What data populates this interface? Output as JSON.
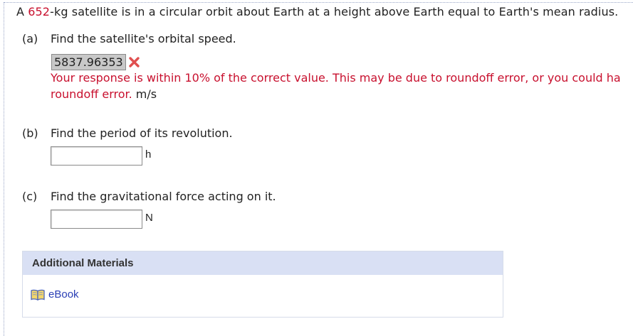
{
  "question": {
    "prefix": "A ",
    "mass": "652",
    "suffix": "-kg satellite is in a circular orbit about Earth at a height above Earth equal to Earth's mean radius."
  },
  "parts": {
    "a": {
      "label": "(a)",
      "prompt": "Find the satellite's orbital speed.",
      "answer_value": "5837.96353",
      "feedback_line1": "Your response is within 10% of the correct value. This may be due to roundoff error, or you could ha",
      "feedback_line2": "roundoff error.",
      "unit": "m/s"
    },
    "b": {
      "label": "(b)",
      "prompt": "Find the period of its revolution.",
      "input_value": "",
      "unit": "h"
    },
    "c": {
      "label": "(c)",
      "prompt": "Find the gravitational force acting on it.",
      "input_value": "",
      "unit": "N"
    }
  },
  "materials": {
    "title": "Additional Materials",
    "ebook_label": "eBook"
  },
  "colors": {
    "error_red": "#c8102e",
    "link_blue": "#2a3fb5",
    "materials_header_bg": "#d9e0f4"
  },
  "icons": {
    "wrong_mark": "x-icon",
    "ebook": "book-icon"
  }
}
